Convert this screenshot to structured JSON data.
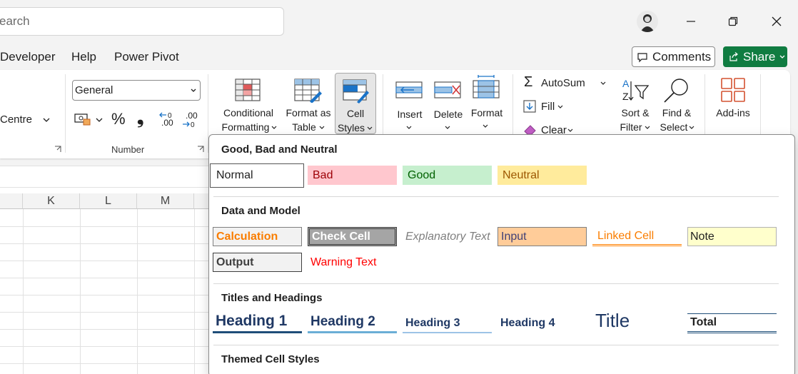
{
  "titlebar": {
    "search_placeholder": "earch"
  },
  "menu": {
    "items": [
      "Developer",
      "Help",
      "Power Pivot"
    ],
    "comments_label": "Comments",
    "share_label": "Share"
  },
  "ribbon": {
    "alignment_partial_label": "Centre",
    "number_format_value": "General",
    "number_group_label": "Number",
    "percent_symbol": "%",
    "comma_symbol": "❟",
    "increase_decimal_label": ".00",
    "decrease_decimal_label": ".00",
    "conditional_formatting_label": [
      "Conditional",
      "Formatting"
    ],
    "format_as_table_label": [
      "Format as",
      "Table"
    ],
    "cell_styles_label": [
      "Cell",
      "Styles"
    ],
    "insert_label": "Insert",
    "delete_label": "Delete",
    "format_label": "Format",
    "autosum_label": "AutoSum",
    "fill_label": "Fill",
    "clear_label": "Clear",
    "sort_filter_label": [
      "Sort &",
      "Filter"
    ],
    "find_select_label": [
      "Find &",
      "Select"
    ],
    "addins_label": "Add-ins"
  },
  "sheet": {
    "columns": [
      "K",
      "L",
      "M"
    ]
  },
  "gallery": {
    "sections": {
      "good_bad_neutral": {
        "title": "Good, Bad and Neutral",
        "styles": [
          "Normal",
          "Bad",
          "Good",
          "Neutral"
        ]
      },
      "data_model": {
        "title": "Data and Model",
        "styles": [
          "Calculation",
          "Check Cell",
          "Explanatory Text",
          "Input",
          "Linked Cell",
          "Note",
          "Output",
          "Warning Text"
        ]
      },
      "titles_headings": {
        "title": "Titles and Headings",
        "styles": [
          "Heading 1",
          "Heading 2",
          "Heading 3",
          "Heading 4",
          "Title",
          "Total"
        ]
      },
      "themed": {
        "title": "Themed Cell Styles"
      }
    }
  },
  "colors": {
    "accent_green": "#107c41",
    "bad_fill": "#ffc7ce",
    "bad_text": "#9c0006",
    "good_fill": "#c6efce",
    "good_text": "#006100",
    "neutral_fill": "#ffeb9c",
    "neutral_text": "#9c5700",
    "heading_blue": "#1f3864"
  }
}
